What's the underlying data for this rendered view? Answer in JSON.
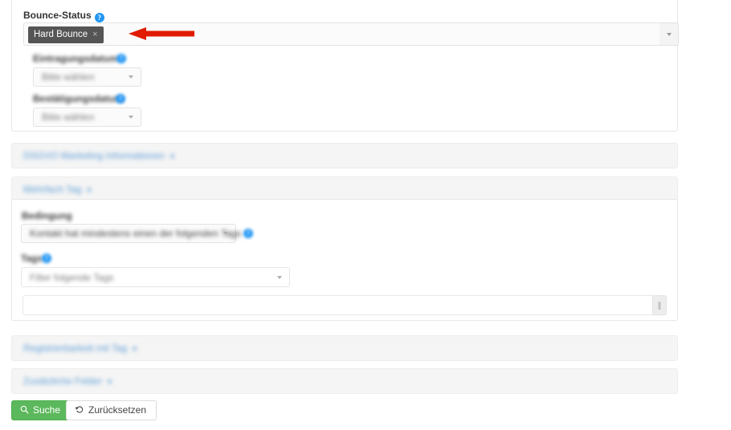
{
  "form": {
    "bounce": {
      "label": "Bounce-Status",
      "help_icon": "help-circle-icon",
      "selected_chips": [
        {
          "label": "Hard Bounce",
          "remove_icon": "×"
        }
      ],
      "dropdown_caret_icon": "chevron-down-icon"
    },
    "field_entry_date": {
      "label": "Eintragungsdatum",
      "help_icon": "help-circle-icon",
      "placeholder": "Bitte wählen"
    },
    "field_confirm_date": {
      "label": "Bestätigungsdatum",
      "help_icon": "help-circle-icon",
      "placeholder": "Bitte wählen"
    }
  },
  "sections": [
    {
      "title": "DSGVO Marketing Informationen",
      "caret_icon": "chevron-down-icon",
      "state": "collapsed"
    },
    {
      "title": "Mehrfach Tag",
      "caret_icon": "chevron-down-icon",
      "state": "expanded"
    },
    {
      "title": "Registrierbarkeit mit Tag",
      "caret_icon": "chevron-down-icon",
      "state": "collapsed"
    },
    {
      "title": "Zusätzliche Felder",
      "caret_icon": "chevron-down-icon",
      "state": "collapsed"
    }
  ],
  "tag_section": {
    "condition_label": "Bedingung",
    "condition_value": "Kontakt hat mindestens einen der folgenden Tags",
    "condition_help_icon": "help-circle-icon",
    "tags_label": "Tags",
    "tags_help_icon": "help-circle-icon",
    "tags_placeholder": "Filter folgende Tags",
    "extra_input_value": ""
  },
  "actions": {
    "search_label": "Suche",
    "search_icon": "search-icon",
    "reset_label": "Zurücksetzen",
    "reset_icon": "undo-icon"
  },
  "annotation": {
    "arrow_icon": "red-arrow-left-icon",
    "color": "#e01b00"
  },
  "colors": {
    "accent_green": "#5cb85c",
    "link_blue": "#5b9bd5",
    "chip_dark": "#555555",
    "help_blue": "#2196f3",
    "panel_bg": "#f5f5f5"
  }
}
